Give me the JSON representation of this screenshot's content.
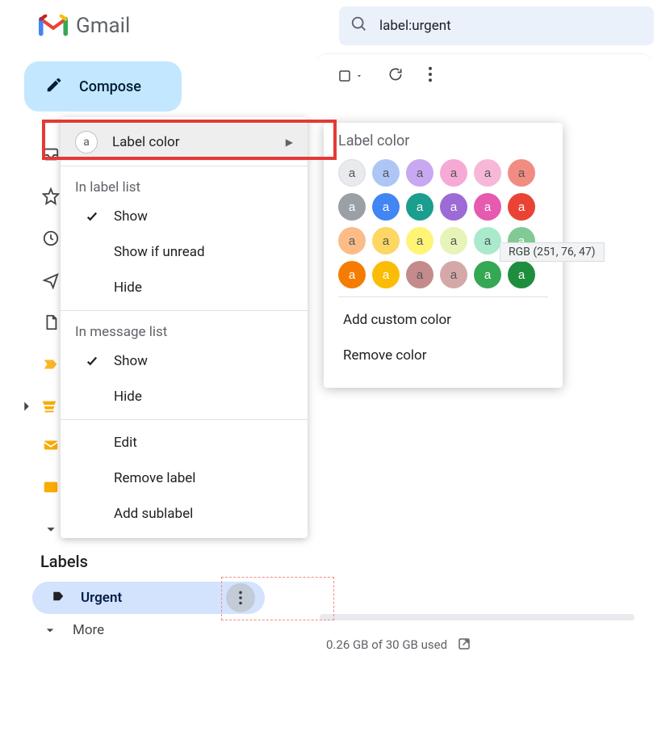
{
  "header": {
    "app_name": "Gmail",
    "search_query": "label:urgent"
  },
  "compose": {
    "label": "Compose"
  },
  "sidebar": {
    "labels_heading": "Labels",
    "urgent_label": "Urgent",
    "more": "More"
  },
  "context_menu": {
    "label_color": "Label color",
    "in_label_list": "In label list",
    "show": "Show",
    "show_if_unread": "Show if unread",
    "hide": "Hide",
    "in_message_list": "In message list",
    "show2": "Show",
    "hide2": "Hide",
    "edit": "Edit",
    "remove_label": "Remove label",
    "add_sublabel": "Add sublabel",
    "swatch_letter": "a"
  },
  "color_menu": {
    "title": "Label color",
    "swatch_letter": "a",
    "colors": [
      {
        "hex": "#e8eaed",
        "text": "light",
        "bordered": true
      },
      {
        "hex": "#aec6f6",
        "text": "light"
      },
      {
        "hex": "#c8a8f0",
        "text": "light"
      },
      {
        "hex": "#f5a9d5",
        "text": "light"
      },
      {
        "hex": "#f7b8d8",
        "text": "light"
      },
      {
        "hex": "#f28b82",
        "text": "light"
      },
      {
        "hex": "#9aa0a6",
        "text": "dark"
      },
      {
        "hex": "#4285f4",
        "text": "dark"
      },
      {
        "hex": "#1a9e8e",
        "text": "dark"
      },
      {
        "hex": "#9c6bd6",
        "text": "dark"
      },
      {
        "hex": "#e65ab0",
        "text": "dark"
      },
      {
        "hex": "#ea4335",
        "text": "dark"
      },
      {
        "hex": "#fbbc88",
        "text": "light"
      },
      {
        "hex": "#fdd663",
        "text": "light"
      },
      {
        "hex": "#fff475",
        "text": "light"
      },
      {
        "hex": "#e6f4b8",
        "text": "light"
      },
      {
        "hex": "#a8eacb",
        "text": "light"
      },
      {
        "hex": "#81c995",
        "text": "dark"
      },
      {
        "hex": "#f57c00",
        "text": "dark"
      },
      {
        "hex": "#fbbc04",
        "text": "dark"
      },
      {
        "hex": "#c38b8b",
        "text": "light"
      },
      {
        "hex": "#d5a8a8",
        "text": "light"
      },
      {
        "hex": "#34a853",
        "text": "dark"
      },
      {
        "hex": "#1e8e3e",
        "text": "dark"
      }
    ],
    "add_custom": "Add custom color",
    "remove_color": "Remove color",
    "tooltip": "RGB (251, 76, 47)"
  },
  "footer": {
    "storage": "0.26 GB of 30 GB used"
  }
}
